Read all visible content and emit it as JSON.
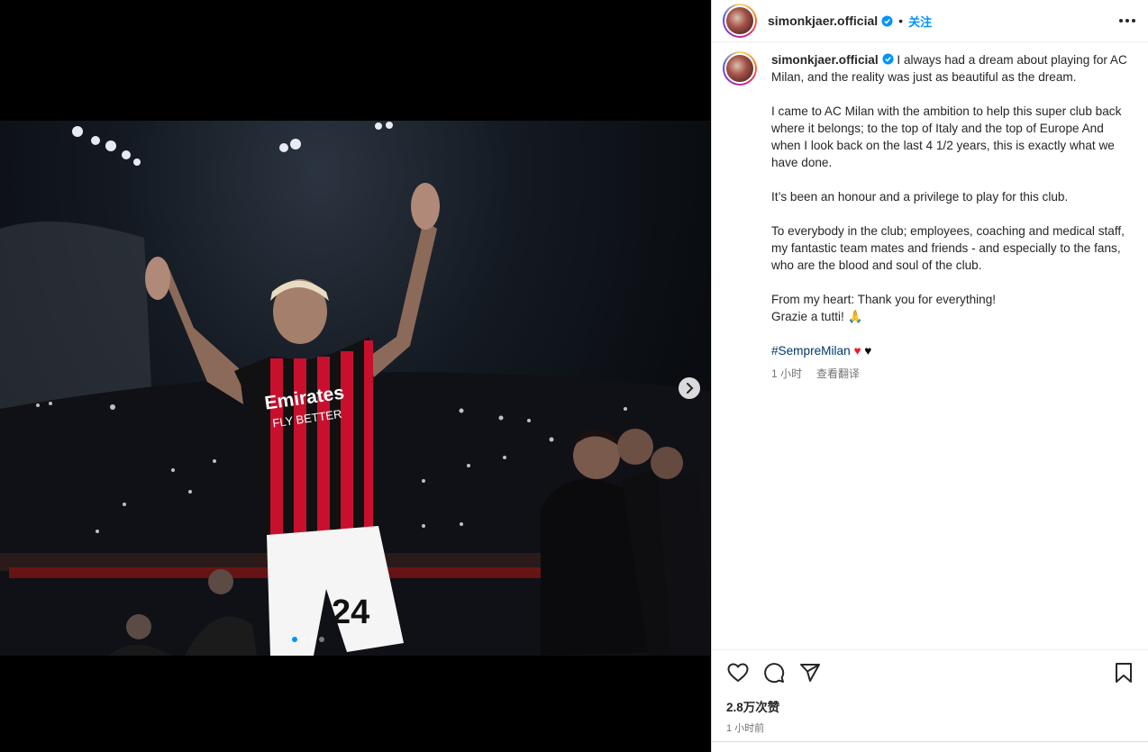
{
  "post": {
    "username": "simonkjaer.official",
    "separator": "•",
    "follow_label": "关注",
    "caption": {
      "intro": "I always had a dream about playing for AC Milan, and the reality was just as beautiful as the dream.",
      "p2": "I came to AC Milan with the ambition to help this super club back where it belongs; to the top of Italy and the top of Europe And when I look back on the last 4 1/2 years, this is exactly what we have done.",
      "p3": "It’s been an honour and a privilege to play for this club.",
      "p4": "To everybody in the club; employees, coaching and medical staff, my fantastic team mates and friends - and especially to the fans, who are the blood and soul of the club.",
      "p5_line1": "From my heart: Thank you for everything!",
      "p5_line2": "Grazie a tutti! 🙏",
      "hashtag": "#SempreMilan",
      "hashtag_emojis": "♥ ♥"
    },
    "caption_time": "1 小时",
    "translate_label": "查看翻译",
    "likes": "2.8万次赞",
    "post_time": "1 小时前"
  },
  "media": {
    "shirt_sponsor_line1": "Emirates",
    "shirt_sponsor_line2": "FLY BETTER",
    "shirt_number": "24",
    "carousel_slides": 4,
    "carousel_active": 1
  },
  "icons": {
    "verified": "verified-badge-icon",
    "more": "more-options-icon",
    "like": "heart-icon",
    "comment": "comment-icon",
    "share": "send-icon",
    "save": "bookmark-icon",
    "next": "chevron-right-icon"
  },
  "colors": {
    "accent": "#0095f6",
    "hashtag": "#00376b",
    "heart_red": "#ed1c24",
    "jersey_red": "#c8102e"
  }
}
